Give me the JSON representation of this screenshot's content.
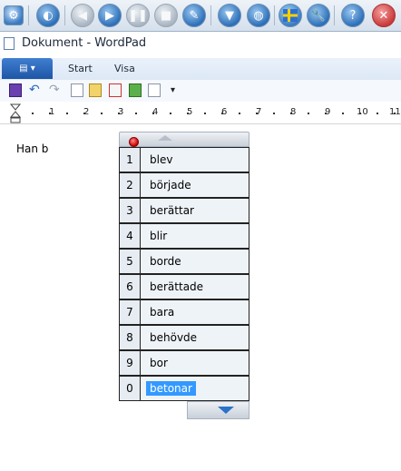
{
  "toolbar": {
    "icons": [
      "settings-icon",
      "speaker-icon",
      "skip-back-icon",
      "play-icon",
      "pause-icon",
      "stop-icon",
      "tools-icon",
      "save-icon",
      "web-icon",
      "flag-icon",
      "wrench-icon",
      "help-icon",
      "close-icon"
    ]
  },
  "window": {
    "title": "Dokument - WordPad"
  },
  "ribbon": {
    "tabs": [
      "Start",
      "Visa"
    ]
  },
  "ruler": {
    "numbers": [
      "1",
      "2",
      "3",
      "4",
      "5",
      "6",
      "7",
      "8",
      "9",
      "10",
      "11"
    ]
  },
  "document": {
    "text": "Han b"
  },
  "suggestions": {
    "items": [
      {
        "num": "1",
        "word": "blev"
      },
      {
        "num": "2",
        "word": "började"
      },
      {
        "num": "3",
        "word": "berättar"
      },
      {
        "num": "4",
        "word": "blir"
      },
      {
        "num": "5",
        "word": "borde"
      },
      {
        "num": "6",
        "word": "berättade"
      },
      {
        "num": "7",
        "word": "bara"
      },
      {
        "num": "8",
        "word": "behövde"
      },
      {
        "num": "9",
        "word": "bor"
      },
      {
        "num": "0",
        "word": "betonar"
      }
    ],
    "selected_index": 9
  },
  "colors": {
    "selection": "#3399ff",
    "accent": "#1e55a6"
  }
}
